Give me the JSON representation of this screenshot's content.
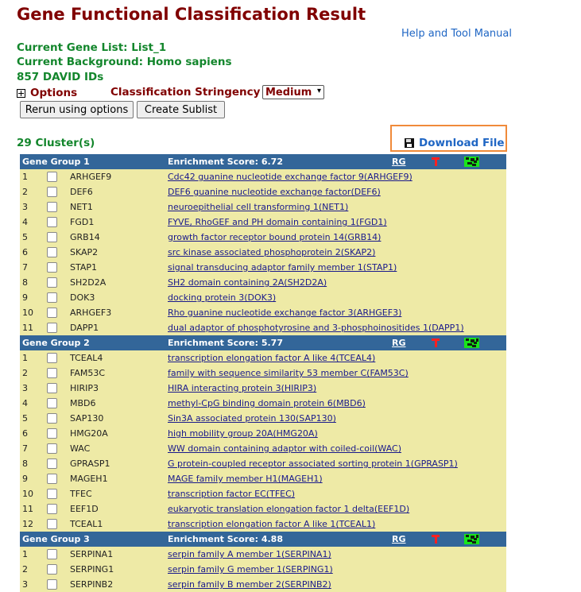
{
  "page": {
    "title": "Gene Functional Classification Result",
    "help_link": "Help and Tool Manual",
    "current_gene_list": "Current Gene List: List_1",
    "current_background": "Current Background: Homo sapiens",
    "david_ids": "857 DAVID IDs",
    "options_label": "Options",
    "stringency_label": "Classification Stringency",
    "stringency_value": "Medium",
    "rerun_button": "Rerun using options",
    "sublist_button": "Create Sublist",
    "cluster_count": "29 Cluster(s)",
    "download_label": "Download File"
  },
  "groups": [
    {
      "name": "Gene Group 1",
      "score": "Enrichment Score: 6.72",
      "rg": "RG",
      "rows": [
        {
          "num": "1",
          "id": "ARHGEF9",
          "name": "Cdc42 guanine nucleotide exchange factor 9(ARHGEF9)"
        },
        {
          "num": "2",
          "id": "DEF6",
          "name": "DEF6 guanine nucleotide exchange factor(DEF6)"
        },
        {
          "num": "3",
          "id": "NET1",
          "name": "neuroepithelial cell transforming 1(NET1)"
        },
        {
          "num": "4",
          "id": "FGD1",
          "name": "FYVE, RhoGEF and PH domain containing 1(FGD1)"
        },
        {
          "num": "5",
          "id": "GRB14",
          "name": "growth factor receptor bound protein 14(GRB14)"
        },
        {
          "num": "6",
          "id": "SKAP2",
          "name": "src kinase associated phosphoprotein 2(SKAP2)"
        },
        {
          "num": "7",
          "id": "STAP1",
          "name": "signal transducing adaptor family member 1(STAP1)"
        },
        {
          "num": "8",
          "id": "SH2D2A",
          "name": "SH2 domain containing 2A(SH2D2A)"
        },
        {
          "num": "9",
          "id": "DOK3",
          "name": "docking protein 3(DOK3)"
        },
        {
          "num": "10",
          "id": "ARHGEF3",
          "name": "Rho guanine nucleotide exchange factor 3(ARHGEF3)"
        },
        {
          "num": "11",
          "id": "DAPP1",
          "name": "dual adaptor of phosphotyrosine and 3-phosphoinositides 1(DAPP1)"
        }
      ]
    },
    {
      "name": "Gene Group 2",
      "score": "Enrichment Score: 5.77",
      "rg": "RG",
      "rows": [
        {
          "num": "1",
          "id": "TCEAL4",
          "name": "transcription elongation factor A like 4(TCEAL4)"
        },
        {
          "num": "2",
          "id": "FAM53C",
          "name": "family with sequence similarity 53 member C(FAM53C)"
        },
        {
          "num": "3",
          "id": "HIRIP3",
          "name": "HIRA interacting protein 3(HIRIP3)"
        },
        {
          "num": "4",
          "id": "MBD6",
          "name": "methyl-CpG binding domain protein 6(MBD6)"
        },
        {
          "num": "5",
          "id": "SAP130",
          "name": "Sin3A associated protein 130(SAP130)"
        },
        {
          "num": "6",
          "id": "HMG20A",
          "name": "high mobility group 20A(HMG20A)"
        },
        {
          "num": "7",
          "id": "WAC",
          "name": "WW domain containing adaptor with coiled-coil(WAC)"
        },
        {
          "num": "8",
          "id": "GPRASP1",
          "name": "G protein-coupled receptor associated sorting protein 1(GPRASP1)"
        },
        {
          "num": "9",
          "id": "MAGEH1",
          "name": "MAGE family member H1(MAGEH1)"
        },
        {
          "num": "10",
          "id": "TFEC",
          "name": "transcription factor EC(TFEC)"
        },
        {
          "num": "11",
          "id": "EEF1D",
          "name": "eukaryotic translation elongation factor 1 delta(EEF1D)"
        },
        {
          "num": "12",
          "id": "TCEAL1",
          "name": "transcription elongation factor A like 1(TCEAL1)"
        }
      ]
    },
    {
      "name": "Gene Group 3",
      "score": "Enrichment Score: 4.88",
      "rg": "RG",
      "rows": [
        {
          "num": "1",
          "id": "SERPINA1",
          "name": "serpin family A member 1(SERPINA1)"
        },
        {
          "num": "2",
          "id": "SERPING1",
          "name": "serpin family G member 1(SERPING1)"
        },
        {
          "num": "3",
          "id": "SERPINB2",
          "name": "serpin family B member 2(SERPINB2)"
        }
      ]
    }
  ]
}
